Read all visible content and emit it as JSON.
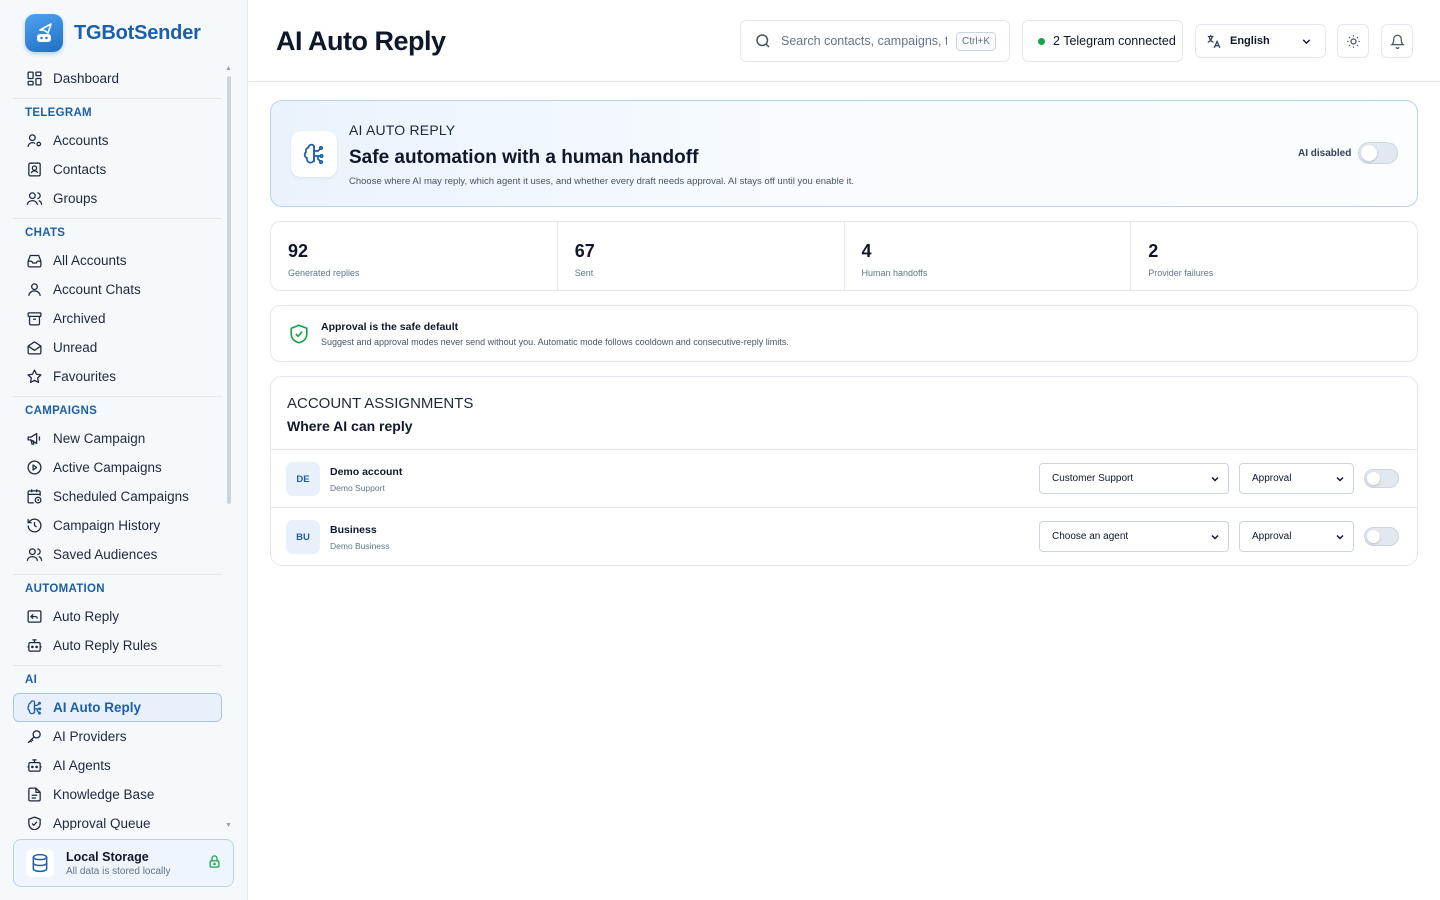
{
  "app": {
    "name": "TGBotSender"
  },
  "sidebar": {
    "dashboard": "Dashboard",
    "sections": {
      "telegram": {
        "title": "TELEGRAM",
        "items": [
          "Accounts",
          "Contacts",
          "Groups"
        ]
      },
      "chats": {
        "title": "CHATS",
        "items": [
          "All Accounts",
          "Account Chats",
          "Archived",
          "Unread",
          "Favourites"
        ]
      },
      "campaigns": {
        "title": "CAMPAIGNS",
        "items": [
          "New Campaign",
          "Active Campaigns",
          "Scheduled Campaigns",
          "Campaign History",
          "Saved Audiences"
        ]
      },
      "automation": {
        "title": "AUTOMATION",
        "items": [
          "Auto Reply",
          "Auto Reply Rules"
        ]
      },
      "ai": {
        "title": "AI",
        "items": [
          "AI Auto Reply",
          "AI Providers",
          "AI Agents",
          "Knowledge Base",
          "Approval Queue"
        ]
      }
    },
    "storage": {
      "title": "Local Storage",
      "subtitle": "All data is stored locally"
    }
  },
  "header": {
    "title": "AI Auto Reply",
    "search_placeholder": "Search contacts, campaigns, t...",
    "search_shortcut": "Ctrl+K",
    "connection_status": "2 Telegram connected",
    "language": "English"
  },
  "hero": {
    "eyebrow": "AI AUTO REPLY",
    "title": "Safe automation with a human handoff",
    "description": "Choose where AI may reply, which agent it uses, and whether every draft needs approval. AI stays off until you enable it.",
    "status_label": "AI disabled",
    "enabled": false
  },
  "stats": [
    {
      "value": "92",
      "label": "Generated replies"
    },
    {
      "value": "67",
      "label": "Sent"
    },
    {
      "value": "4",
      "label": "Human handoffs"
    },
    {
      "value": "2",
      "label": "Provider failures"
    }
  ],
  "notice": {
    "title": "Approval is the safe default",
    "description": "Suggest and approval modes never send without you. Automatic mode follows cooldown and consecutive-reply limits."
  },
  "assignments": {
    "eyebrow": "ACCOUNT ASSIGNMENTS",
    "title": "Where AI can reply",
    "rows": [
      {
        "initials": "DE",
        "name": "Demo account",
        "subtitle": "Demo Support",
        "agent": "Customer Support",
        "mode": "Approval",
        "enabled": false
      },
      {
        "initials": "BU",
        "name": "Business",
        "subtitle": "Demo Business",
        "agent": "Choose an agent",
        "mode": "Approval",
        "enabled": false
      }
    ]
  },
  "colors": {
    "accent": "#1d5fa8",
    "connected": "#16a34a",
    "shield": "#16a34a"
  }
}
